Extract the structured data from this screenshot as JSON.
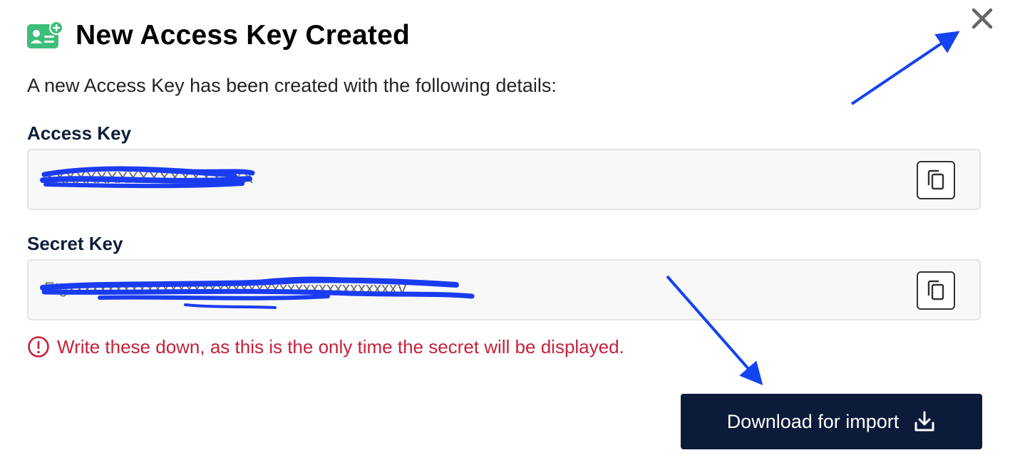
{
  "dialog": {
    "title": "New Access Key Created",
    "description": "A new Access Key has been created with the following details:",
    "header_icon": "id-card-add-icon",
    "close_icon": "close-icon"
  },
  "fields": {
    "access_key": {
      "label": "Access Key",
      "value": "XXXXXXXXXXXXXXXXXXXX",
      "copy_icon": "copy-icon"
    },
    "secret_key": {
      "label": "Secret Key",
      "value": "EtgxxxxxxxxxxxxxxxxxxxxxxxxxxxxxxxxxxxxxxxxxxV",
      "copy_icon": "copy-icon"
    }
  },
  "warning": {
    "text": "Write these down, as this is the only time the secret will be displayed.",
    "icon": "exclamation-circle-icon",
    "color": "#c5223a"
  },
  "actions": {
    "download_label": "Download for import",
    "download_icon": "download-icon"
  },
  "colors": {
    "accent_green": "#3fbd7a",
    "button_navy": "#0b1b39",
    "label_navy": "#0e1f3b",
    "annotation_blue": "#1443f0"
  }
}
